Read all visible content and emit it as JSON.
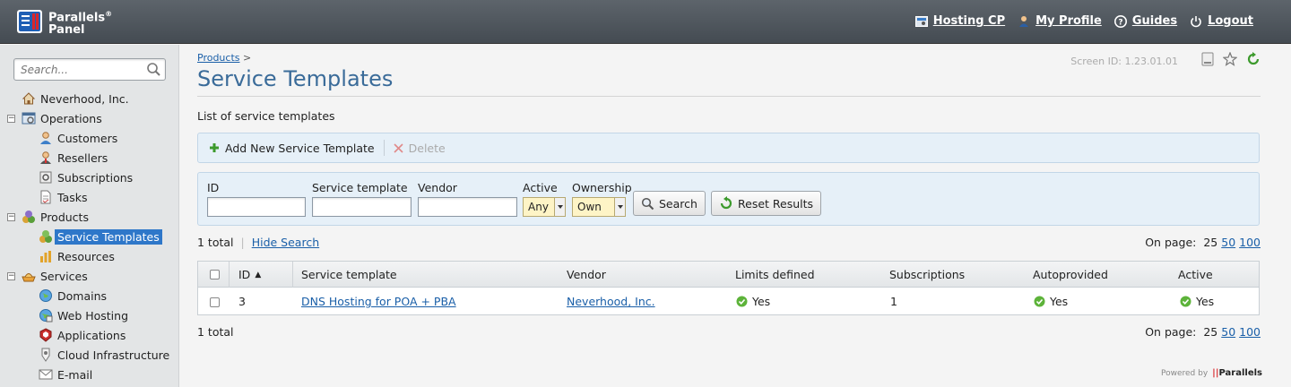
{
  "app": {
    "brand_line1": "Parallels",
    "brand_reg": "®",
    "brand_line2": "Panel"
  },
  "topnav": [
    {
      "label": "Hosting CP",
      "icon": "hosting-cp-icon"
    },
    {
      "label": "My Profile",
      "icon": "user-icon"
    },
    {
      "label": "Guides",
      "icon": "help-icon"
    },
    {
      "label": "Logout",
      "icon": "power-icon"
    }
  ],
  "sidebar": {
    "search_placeholder": "Search...",
    "items": [
      {
        "label": "Neverhood, Inc.",
        "icon": "home-icon"
      },
      {
        "label": "Operations",
        "icon": "operations-icon",
        "toggle": "minus"
      },
      {
        "label": "Customers",
        "icon": "customer-icon"
      },
      {
        "label": "Resellers",
        "icon": "reseller-icon"
      },
      {
        "label": "Subscriptions",
        "icon": "subscription-icon"
      },
      {
        "label": "Tasks",
        "icon": "tasks-icon"
      },
      {
        "label": "Products",
        "icon": "products-icon",
        "toggle": "minus"
      },
      {
        "label": "Service Templates",
        "icon": "service-templates-icon",
        "selected": true
      },
      {
        "label": "Resources",
        "icon": "resources-icon"
      },
      {
        "label": "Services",
        "icon": "services-icon",
        "toggle": "minus"
      },
      {
        "label": "Domains",
        "icon": "globe-icon"
      },
      {
        "label": "Web Hosting",
        "icon": "web-hosting-icon"
      },
      {
        "label": "Applications",
        "icon": "applications-icon"
      },
      {
        "label": "Cloud Infrastructure",
        "icon": "cloud-icon"
      },
      {
        "label": "E-mail",
        "icon": "email-icon"
      }
    ]
  },
  "page": {
    "breadcrumb_link": "Products",
    "breadcrumb_sep": ">",
    "title": "Service Templates",
    "screen_id": "Screen ID:  1.23.01.01",
    "description": "List of service templates"
  },
  "toolbar": {
    "add_label": "Add New Service Template",
    "delete_label": "Delete"
  },
  "filter": {
    "id_label": "ID",
    "template_label": "Service template",
    "vendor_label": "Vendor",
    "active_label": "Active",
    "active_value": "Any",
    "ownership_label": "Ownership",
    "ownership_value": "Own",
    "search_button": "Search",
    "reset_button": "Reset Results"
  },
  "list": {
    "total_top": "1 total",
    "hide_search": "Hide Search",
    "on_page_label": "On page:",
    "page_sizes": [
      "25",
      "50",
      "100"
    ],
    "total_bottom": "1 total"
  },
  "table": {
    "columns": [
      "ID",
      "Service template",
      "Vendor",
      "Limits defined",
      "Subscriptions",
      "Autoprovided",
      "Active"
    ],
    "sort_indicator": "▲",
    "rows": [
      {
        "id": "3",
        "template": "DNS Hosting for POA + PBA",
        "vendor": "Neverhood, Inc.",
        "limits": "Yes",
        "subscriptions": "1",
        "autoprovided": "Yes",
        "active": "Yes"
      }
    ]
  },
  "footer": {
    "powered_by": "Powered by",
    "brand": "Parallels"
  },
  "colors": {
    "accent": "#2e77c9",
    "title": "#3a6b99",
    "link": "#1a5fa8",
    "ok": "#5db33a"
  }
}
